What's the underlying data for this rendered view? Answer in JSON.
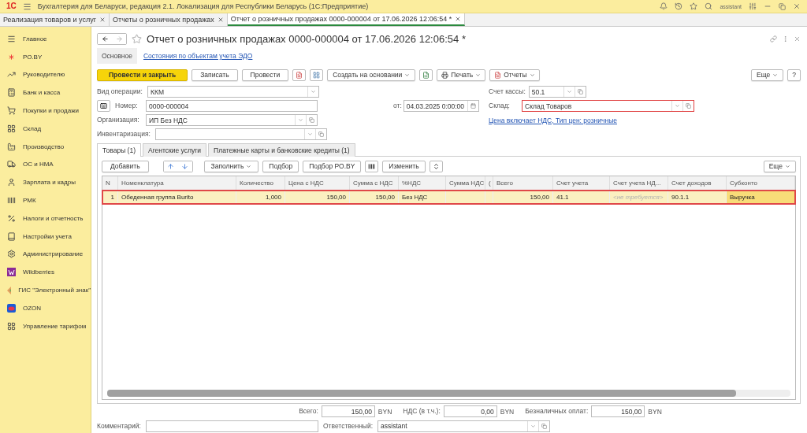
{
  "app_bar": {
    "logo": "1С",
    "title": "Бухгалтерия для Беларуси, редакция 2.1. Локализация для Республики Беларусь  (1С:Предприятие)",
    "user": "assistant"
  },
  "open_tabs": [
    {
      "label": "Реализация товаров и услуг",
      "selected": false
    },
    {
      "label": "Отчеты о розничных продажах",
      "selected": false
    },
    {
      "label": "Отчет о розничных продажах 0000-000004 от 17.06.2026 12:06:54 *",
      "selected": true
    }
  ],
  "sidebar": {
    "items": [
      {
        "label": "Главное"
      },
      {
        "label": "РО.BY"
      },
      {
        "label": "Руководителю"
      },
      {
        "label": "Банк и касса"
      },
      {
        "label": "Покупки и продажи"
      },
      {
        "label": "Склад"
      },
      {
        "label": "Производство"
      },
      {
        "label": "ОС и НМА"
      },
      {
        "label": "Зарплата и кадры"
      },
      {
        "label": "РМК"
      },
      {
        "label": "Налоги и отчетность"
      },
      {
        "label": "Настройки учета"
      },
      {
        "label": "Администрирование"
      },
      {
        "label": "Wildberries"
      },
      {
        "label": "ГИС \"Электронный знак\""
      },
      {
        "label": "OZON"
      },
      {
        "label": "Управление тарифом"
      }
    ]
  },
  "document": {
    "title": "Отчет о розничных продажах 0000-000004 от 17.06.2026 12:06:54 *",
    "sections": [
      {
        "label": "Основное",
        "selected": true
      },
      {
        "label": "Состояния по объектам учета ЭДО",
        "selected": false
      }
    ],
    "toolbar": {
      "post_close": "Провести и закрыть",
      "save": "Записать",
      "post": "Провести",
      "create_based": "Создать на основании",
      "print": "Печать",
      "reports": "Отчеты",
      "more": "Еще",
      "help": "?"
    },
    "fields": {
      "operation": {
        "label": "Вид операции:",
        "value": "ККМ",
        "highlighted": false
      },
      "number": {
        "label": "Номер:",
        "value": "0000-000004"
      },
      "date": {
        "label": "от:",
        "value": "04.03.2025  0:00:00"
      },
      "organization": {
        "label": "Организация:",
        "value": "ИП Без НДС",
        "highlighted": false
      },
      "inventory": {
        "label": "Инвентаризация:",
        "highlighted": false
      },
      "cash_account": {
        "label": "Счет кассы:",
        "value": "50.1",
        "highlighted": false
      },
      "warehouse": {
        "label": "Склад:",
        "value": "Склад Товаров",
        "highlighted": true
      },
      "price_link": "Цена включает НДС, Тип цен: розничные"
    },
    "tabs": [
      {
        "label": "Товары (1)",
        "selected": true
      },
      {
        "label": "Агентские услуги",
        "selected": false
      },
      {
        "label": "Платежные карты и банковские кредиты (1)",
        "selected": false
      }
    ],
    "table_toolbar": {
      "add": "Добавить",
      "fill": "Заполнить",
      "pick": "Подбор",
      "pick_ro": "Подбор РО.BY",
      "change": "Изменить",
      "more": "Еще"
    },
    "table": {
      "columns": [
        "N",
        "Номенклатура",
        "Количество",
        "Цена с НДС",
        "Сумма с НДС",
        "%НДС",
        "Сумма НДС",
        "(",
        "Всего",
        "Счет учета",
        "Счет учета НД...",
        "Счет доходов",
        "Субконто"
      ],
      "rows": [
        {
          "selected": true,
          "highlighted": true,
          "cells": [
            {
              "text": "1",
              "active": false,
              "muted": false
            },
            {
              "text": "Обеденная группа Burito",
              "active": false,
              "muted": false
            },
            {
              "text": "1,000",
              "active": false,
              "muted": false
            },
            {
              "text": "150,00",
              "active": false,
              "muted": false
            },
            {
              "text": "150,00",
              "active": false,
              "muted": false
            },
            {
              "text": "Без НДС",
              "active": false,
              "muted": false
            },
            {
              "active": false
            },
            {
              "active": false
            },
            {
              "text": "150,00",
              "active": false,
              "muted": false
            },
            {
              "text": "41.1",
              "active": false,
              "muted": false
            },
            {
              "text": "<не требуется>",
              "active": false,
              "muted": true
            },
            {
              "text": "90.1.1",
              "active": false,
              "muted": false
            },
            {
              "text": "Выручка",
              "active": true,
              "muted": false
            }
          ]
        }
      ]
    },
    "totals": [
      {
        "label": "Всего:",
        "value": "150,00",
        "currency": "BYN"
      },
      {
        "label": "НДС (в т.ч.):",
        "value": "0,00",
        "currency": "BYN"
      },
      {
        "label": "Безналичных оплат:",
        "value": "150,00",
        "currency": "BYN"
      }
    ],
    "comment": {
      "label": "Комментарий:"
    },
    "responsible": {
      "label": "Ответственный:",
      "value": "assistant"
    }
  }
}
